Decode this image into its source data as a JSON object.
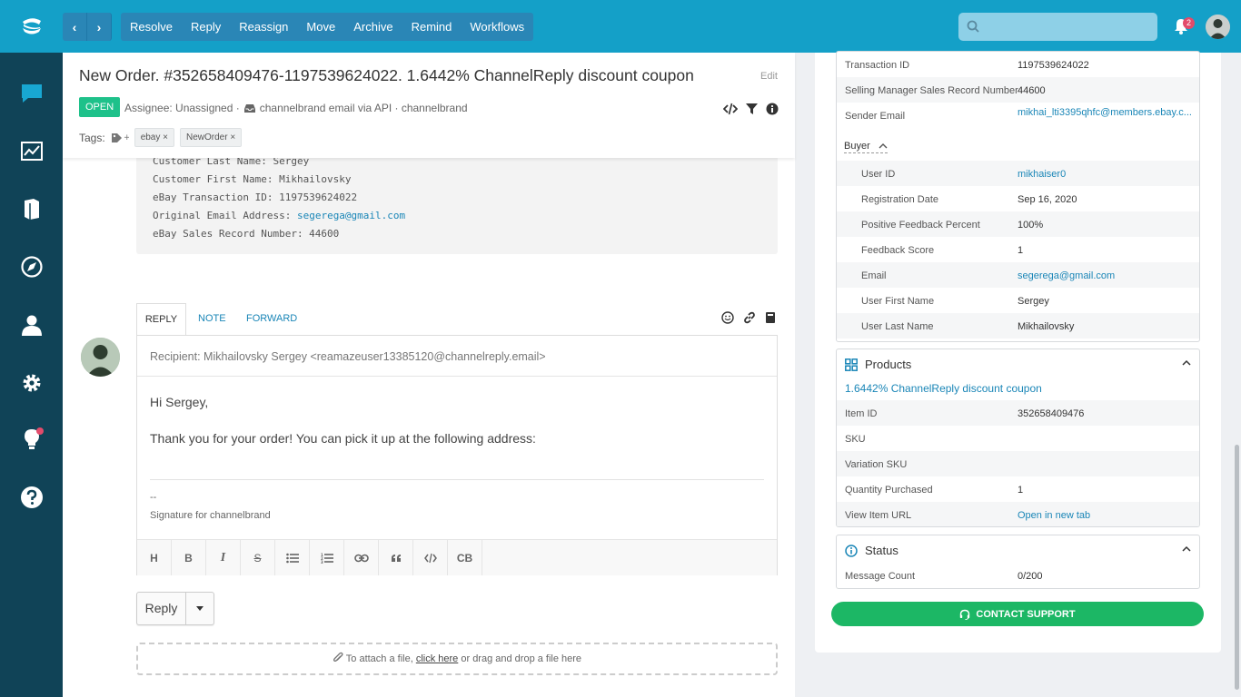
{
  "topbar": {
    "actions": [
      "Resolve",
      "Reply",
      "Reassign",
      "Move",
      "Archive",
      "Remind",
      "Workflows"
    ],
    "notification_count": "2",
    "brand_color": "#14a0c8"
  },
  "ticket": {
    "title": "New Order. #352658409476-1197539624022. 1.6442% ChannelReply discount coupon",
    "edit_label": "Edit",
    "status": "OPEN",
    "assignee": "Assignee: Unassigned ·",
    "channel": "channelbrand email via API · channelbrand",
    "tags_label": "Tags:",
    "tags": [
      "ebay ×",
      "NewOrder ×"
    ]
  },
  "message": {
    "lines": [
      "Customer Last Name: Sergey",
      "Customer First Name: Mikhailovsky",
      "eBay Transaction ID: 1197539624022",
      "Original Email Address: ",
      "eBay Sales Record Number: 44600"
    ],
    "email_link": "segerega@gmail.com"
  },
  "reply": {
    "tabs": [
      "REPLY",
      "NOTE",
      "FORWARD"
    ],
    "recipient": "Recipient: Mikhailovsky Sergey <reamazeuser13385120@channelreply.email>",
    "greeting": "Hi Sergey,",
    "body": "Thank you for your order! You can pick it up at the following address:",
    "sig_dash": "--",
    "signature": "Signature for channelbrand",
    "format_buttons": [
      "H",
      "B",
      "I",
      "S",
      "ul",
      "ol",
      "link",
      "quote",
      "code",
      "CB"
    ],
    "send_label": "Reply",
    "attach_pre": "To attach a file, ",
    "attach_link": "click here",
    "attach_post": " or drag and drop a file here"
  },
  "order_details": {
    "rows": [
      {
        "k": "Transaction ID",
        "v": "1197539624022"
      },
      {
        "k": "Selling Manager Sales Record Number",
        "v": "44600"
      },
      {
        "k": "Sender Email",
        "v": "mikhai_lti3395qhfc@members.ebay.c..."
      }
    ],
    "buyer_label": "Buyer",
    "buyer_rows": [
      {
        "k": "User ID",
        "v": "mikhaiser0"
      },
      {
        "k": "Registration Date",
        "v": "Sep 16, 2020"
      },
      {
        "k": "Positive Feedback Percent",
        "v": "100%"
      },
      {
        "k": "Feedback Score",
        "v": "1"
      },
      {
        "k": "Email",
        "v": "segerega@gmail.com"
      },
      {
        "k": "User First Name",
        "v": "Sergey"
      },
      {
        "k": "User Last Name",
        "v": "Mikhailovsky"
      }
    ]
  },
  "products": {
    "title": "Products",
    "product_link": "1.6442% ChannelReply discount coupon",
    "rows": [
      {
        "k": "Item ID",
        "v": "352658409476"
      },
      {
        "k": "SKU",
        "v": ""
      },
      {
        "k": "Variation SKU",
        "v": ""
      },
      {
        "k": "Quantity Purchased",
        "v": "1"
      },
      {
        "k": "View Item URL",
        "v": "Open in new tab"
      }
    ]
  },
  "status_card": {
    "title": "Status",
    "rows": [
      {
        "k": "Message Count",
        "v": "0/200"
      }
    ]
  },
  "contact_support": "CONTACT SUPPORT"
}
